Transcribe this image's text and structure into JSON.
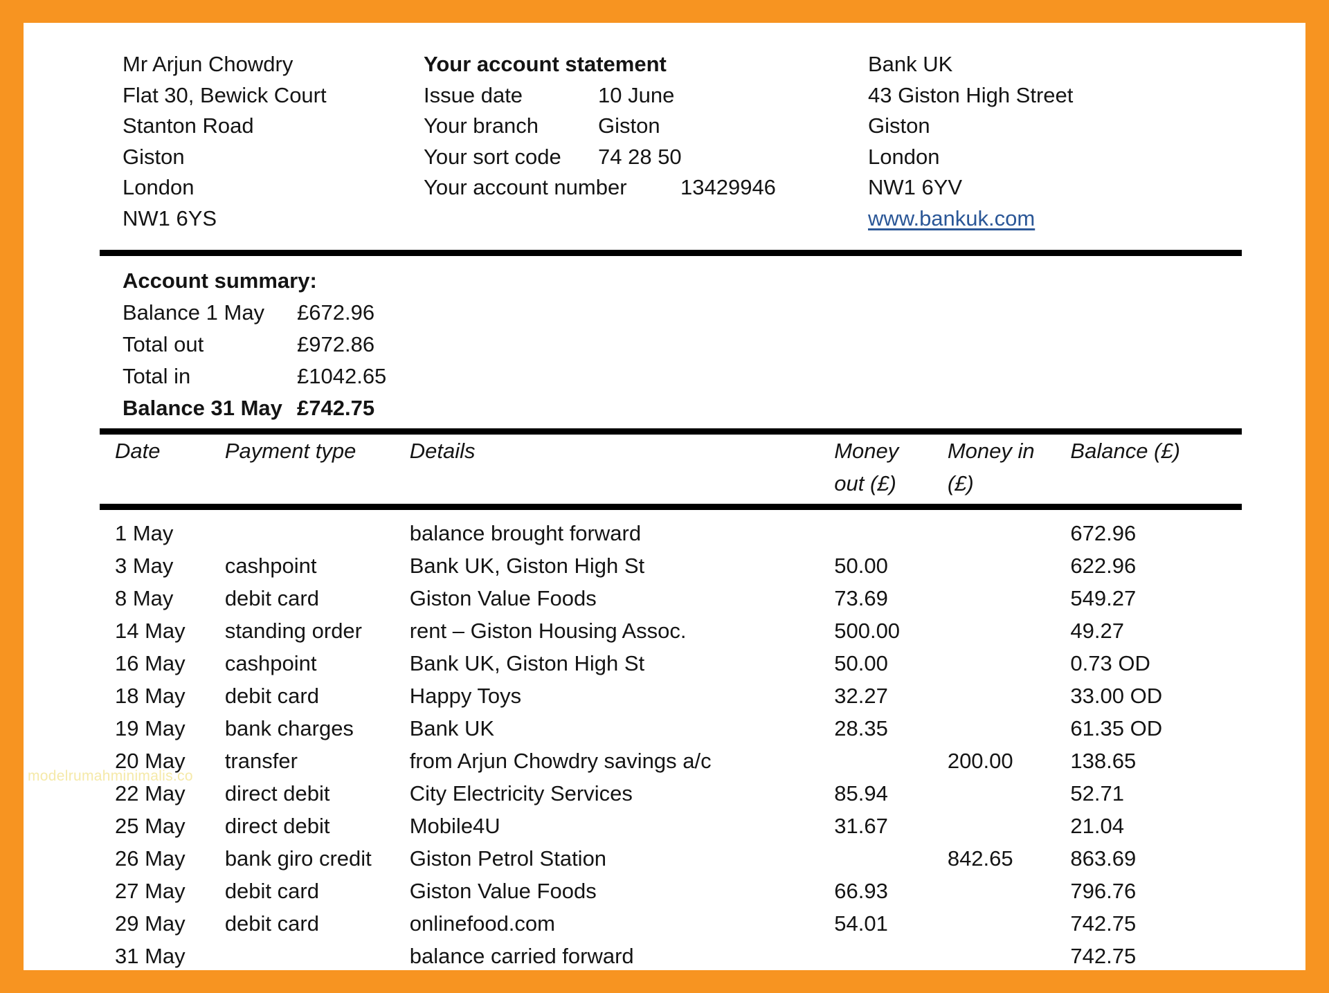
{
  "document": {
    "type": "bank-statement",
    "border_color": "#f79421",
    "page_background": "#ffffff",
    "link_color": "#2b5797"
  },
  "customer": {
    "lines": [
      "Mr Arjun Chowdry",
      "Flat 30, Bewick Court",
      "Stanton Road",
      "Giston",
      "London",
      "NW1 6YS"
    ]
  },
  "statement": {
    "title": "Your account statement",
    "fields": [
      {
        "label": "Issue date",
        "value": "10 June"
      },
      {
        "label": "Your branch",
        "value": "Giston"
      },
      {
        "label": "Your sort code",
        "value": "74 28 50"
      },
      {
        "label": "Your account number",
        "value": "13429946"
      }
    ]
  },
  "bank": {
    "lines": [
      "Bank UK",
      "43 Giston High Street",
      "Giston",
      "London",
      "NW1 6YV"
    ],
    "website": "www.bankuk.com"
  },
  "summary": {
    "title": "Account summary:",
    "rows": [
      {
        "label": "Balance 1 May",
        "amount": "£672.96",
        "bold": false
      },
      {
        "label": "Total out",
        "amount": "£972.86",
        "bold": false
      },
      {
        "label": "Total in",
        "amount": "£1042.65",
        "bold": false
      },
      {
        "label": "Balance 31 May",
        "amount": "£742.75",
        "bold": true
      }
    ]
  },
  "transactions": {
    "headers": {
      "date": "Date",
      "payment_type": "Payment type",
      "details": "Details",
      "money_out": "Money out (£)",
      "money_out_l1": "Money",
      "money_out_l2": "out (£)",
      "money_in": "Money in (£)",
      "money_in_l1": "Money in",
      "money_in_l2": "(£)",
      "balance": "Balance (£)"
    },
    "rows": [
      {
        "date": "1 May",
        "type": "",
        "details": "balance brought forward",
        "out": "",
        "in": "",
        "balance": "672.96",
        "bold": true
      },
      {
        "date": "3 May",
        "type": "cashpoint",
        "details": "Bank UK, Giston High St",
        "out": "50.00",
        "in": "",
        "balance": "622.96",
        "bold": false
      },
      {
        "date": "8 May",
        "type": "debit card",
        "details": "Giston Value Foods",
        "out": "73.69",
        "in": "",
        "balance": "549.27",
        "bold": false
      },
      {
        "date": "14 May",
        "type": "standing order",
        "details": "rent – Giston Housing Assoc.",
        "out": "500.00",
        "in": "",
        "balance": "49.27",
        "bold": false
      },
      {
        "date": "16 May",
        "type": "cashpoint",
        "details": "Bank UK, Giston High St",
        "out": "50.00",
        "in": "",
        "balance": "0.73 OD",
        "bold": false
      },
      {
        "date": "18 May",
        "type": "debit card",
        "details": "Happy Toys",
        "out": "32.27",
        "in": "",
        "balance": "33.00 OD",
        "bold": false
      },
      {
        "date": "19 May",
        "type": "bank charges",
        "details": "Bank UK",
        "out": "28.35",
        "in": "",
        "balance": "61.35 OD",
        "bold": false
      },
      {
        "date": "20 May",
        "type": "transfer",
        "details": "from Arjun Chowdry savings a/c",
        "out": "",
        "in": "200.00",
        "balance": "138.65",
        "bold": false
      },
      {
        "date": "22 May",
        "type": "direct debit",
        "details": "City Electricity Services",
        "out": "85.94",
        "in": "",
        "balance": "52.71",
        "bold": false
      },
      {
        "date": "25 May",
        "type": "direct debit",
        "details": "Mobile4U",
        "out": "31.67",
        "in": "",
        "balance": "21.04",
        "bold": false
      },
      {
        "date": "26 May",
        "type": "bank giro credit",
        "details": "Giston Petrol Station",
        "out": "",
        "in": "842.65",
        "balance": "863.69",
        "bold": false
      },
      {
        "date": "27 May",
        "type": "debit card",
        "details": "Giston Value Foods",
        "out": "66.93",
        "in": "",
        "balance": "796.76",
        "bold": false
      },
      {
        "date": "29 May",
        "type": "debit card",
        "details": "onlinefood.com",
        "out": "54.01",
        "in": "",
        "balance": "742.75",
        "bold": false
      },
      {
        "date": "31 May",
        "type": "",
        "details": "balance carried forward",
        "out": "",
        "in": "",
        "balance": "742.75",
        "bold": true
      }
    ]
  },
  "watermark": {
    "text": "modelrumahminimalis.co"
  }
}
